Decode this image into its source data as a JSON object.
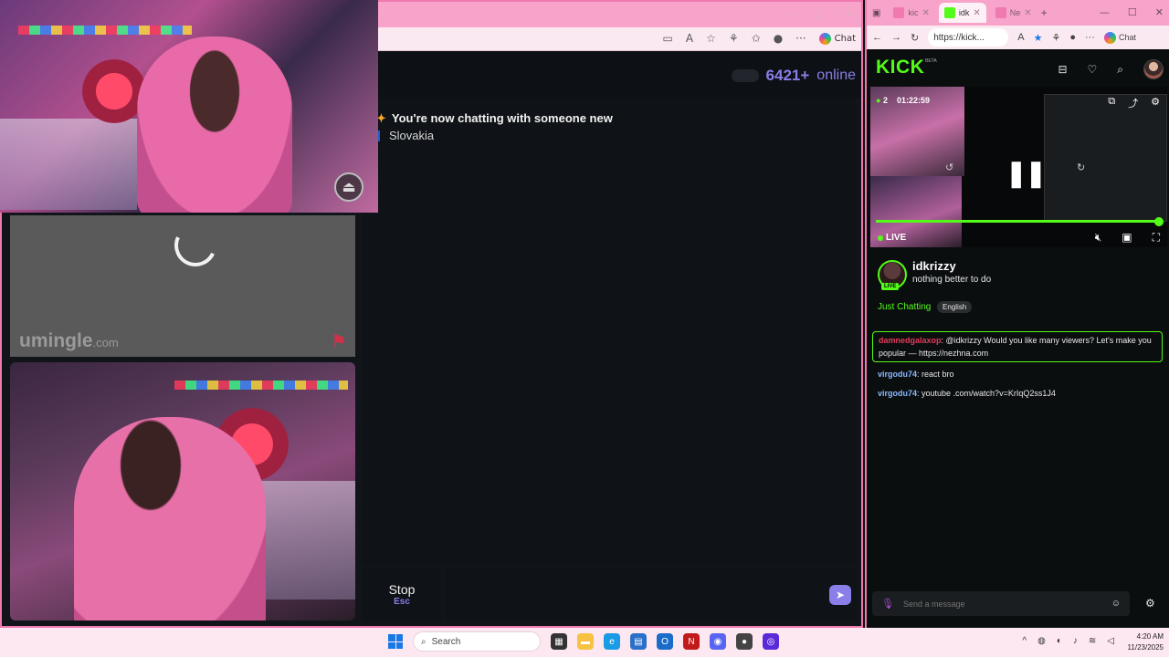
{
  "left_browser": {
    "toolbar": {
      "chat_label": "Chat"
    }
  },
  "umingle": {
    "online_count": "6421+",
    "online_word": "online",
    "logo": {
      "main": "umingle",
      "suffix": ".com"
    },
    "messages": [
      {
        "text": "You're now chatting with someone new"
      },
      {
        "text": "Slovakia"
      }
    ],
    "stop_button": {
      "label": "Stop",
      "shortcut": "Esc"
    },
    "message_input": {
      "placeholder": ""
    }
  },
  "right_browser": {
    "tabs": [
      {
        "label": "kic",
        "color": "#f07ab0",
        "active": false
      },
      {
        "label": "idk",
        "color": "#53fc18",
        "active": true
      },
      {
        "label": "Ne",
        "color": "#f07ab0",
        "active": false
      }
    ],
    "url": "https://kick...",
    "chat_label": "Chat"
  },
  "kick": {
    "logo": "KICK",
    "beta": "BETA",
    "player": {
      "viewers": "2",
      "duration": "01:22:59",
      "live_label": "LIVE",
      "progress": 1.0
    },
    "streamer": {
      "name": "idkrizzy",
      "live_badge": "LIVE",
      "title": "nothing better to do",
      "category": "Just Chatting",
      "language": "English"
    },
    "chat": [
      {
        "user": "damnedgalaxop",
        "user_color": "#e23b5a",
        "text": ": @idkrizzy Would you like many viewers? Let's make you popular — https://nezhna.com"
      },
      {
        "user": "virgodu74",
        "user_color": "#8ab8ff",
        "text": ": react bro"
      },
      {
        "user": "virgodu74",
        "user_color": "#8ab8ff",
        "text": ": youtube .com/watch?v=KrIqQ2ss1J4"
      }
    ],
    "send_placeholder": "Send a message"
  },
  "taskbar": {
    "search_label": "Search",
    "time": "4:20 AM",
    "date": "11/23/2025"
  },
  "colors": {
    "kick_green": "#53fc18",
    "umingle_purple": "#8a7ee8",
    "frame_pink": "#f07ab0"
  }
}
